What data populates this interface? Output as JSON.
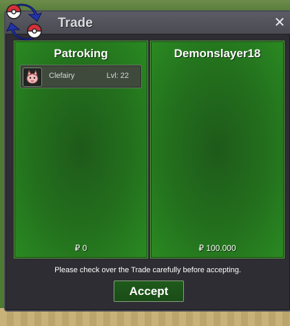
{
  "window": {
    "title": "Trade",
    "close_glyph": "✕"
  },
  "panels": [
    {
      "name": "Patroking",
      "money": "₽ 0",
      "items": [
        {
          "name": "Clefairy",
          "level": "Lvl: 22",
          "icon": "clefairy-icon"
        }
      ]
    },
    {
      "name": "Demonslayer18",
      "money": "₽ 100.000",
      "items": []
    }
  ],
  "notice": "Please check over the Trade carefully before accepting.",
  "accept_label": "Accept",
  "colors": {
    "panel_green": "#23701d",
    "window_bg": "#2d2d33",
    "accent_red": "#d6303a"
  }
}
